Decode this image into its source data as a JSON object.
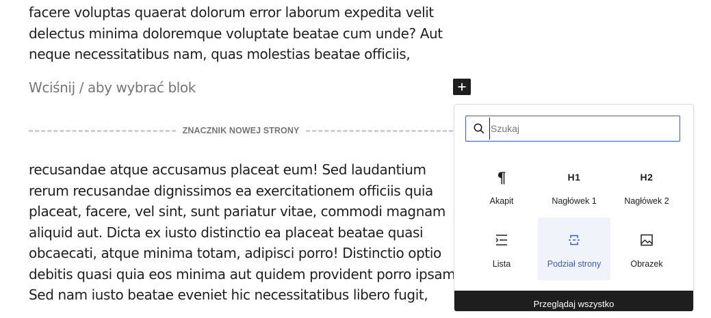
{
  "editor": {
    "paragraph_top": [
      "facere voluptas quaerat dolorum error laborum expedita velit",
      "delectus minima doloremque voluptate beatae cum unde? Aut",
      "neque necessitatibus nam, quas molestias beatae officiis,"
    ],
    "placeholder": "Wciśnij / aby wybrać blok",
    "page_break_label": "ZNACZNIK NOWEJ STRONY",
    "paragraph_bottom": [
      "recusandae atque accusamus placeat eum! Sed laudantium",
      "rerum recusandae dignissimos ea exercitationem officiis quia",
      "placeat, facere, vel sint, sunt pariatur vitae, commodi magnam",
      "aliquid aut. Dicta ex iusto distinctio ea placeat beatae quasi",
      "obcaecati, atque minima totam, adipisci porro! Distinctio optio",
      "debitis quasi quia eos minima aut quidem provident porro ipsam",
      "Sed nam iusto beatae eveniet hic necessitatibus libero fugit,"
    ]
  },
  "inserter": {
    "search_placeholder": "Szukaj",
    "blocks": [
      {
        "label": "Akapit",
        "icon": "paragraph-icon"
      },
      {
        "label": "Nagłówek 1",
        "icon": "heading-1-icon"
      },
      {
        "label": "Nagłówek 2",
        "icon": "heading-2-icon"
      },
      {
        "label": "Lista",
        "icon": "list-icon"
      },
      {
        "label": "Podział strony",
        "icon": "page-break-icon"
      },
      {
        "label": "Obrazek",
        "icon": "image-icon"
      }
    ],
    "footer_label": "Przeglądaj wszystko"
  },
  "colors": {
    "accent": "#3858e9",
    "dark": "#1e1e1e",
    "muted": "#757575",
    "active_bg": "#f0f3fa"
  }
}
